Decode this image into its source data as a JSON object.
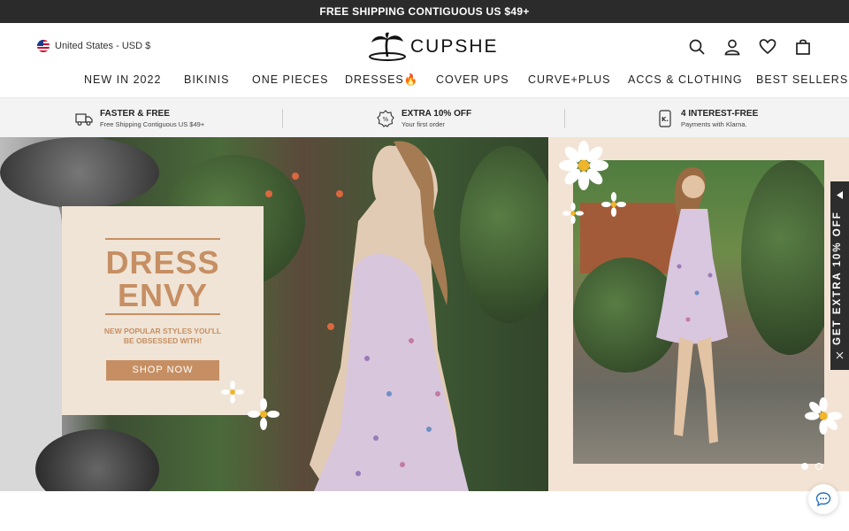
{
  "topbar": {
    "text": "FREE SHIPPING CONTIGUOUS US $49+"
  },
  "header": {
    "region": "United States - USD $",
    "logo": "CUPSHE",
    "icons": [
      "search-icon",
      "account-icon",
      "wishlist-icon",
      "cart-icon"
    ]
  },
  "nav": {
    "items": [
      "NEW IN 2022",
      "BIKINIS",
      "ONE PIECES",
      "DRESSES🔥",
      "COVER UPS",
      "CURVE+PLUS",
      "ACCS & CLOTHING",
      "BEST SELLERS"
    ]
  },
  "perks": [
    {
      "title": "FASTER & FREE",
      "sub": "Free Shipping Contiguous US $49+",
      "icon": "truck-icon"
    },
    {
      "title": "EXTRA 10% OFF",
      "sub": "Your first order",
      "icon": "discount-badge-icon"
    },
    {
      "title": "4 INTEREST-FREE",
      "sub": "Payments with Klarna.",
      "icon": "klarna-icon"
    }
  ],
  "hero": {
    "title_line1": "DRESS",
    "title_line2": "ENVY",
    "subtitle_line1": "NEW POPULAR STYLES YOU'LL",
    "subtitle_line2": "BE OBSESSED WITH!",
    "cta": "SHOP NOW",
    "slide_count": 2,
    "active_slide": 1
  },
  "side_tab": {
    "text": "GET EXTRA 10% OFF"
  },
  "colors": {
    "accent": "#c68f63",
    "topbar": "#2b2b2b",
    "promo_bg": "#efe4d6"
  }
}
